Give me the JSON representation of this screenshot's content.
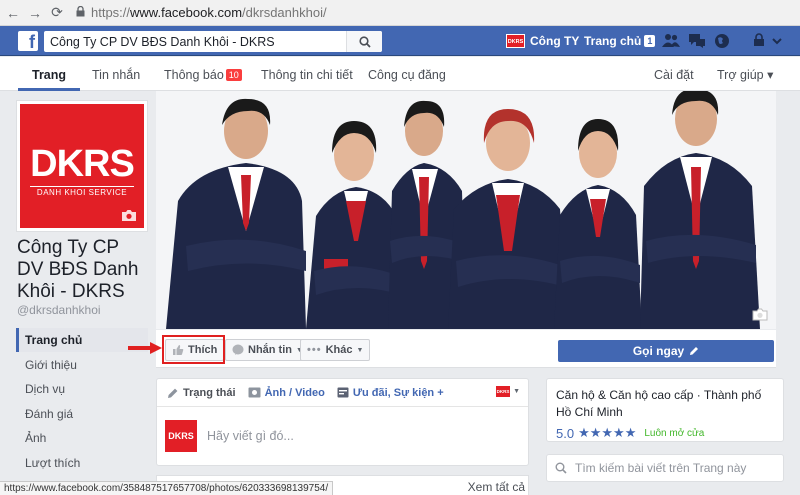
{
  "browser": {
    "url_scheme": "https://",
    "url_host": "www.facebook.com",
    "url_path": "/dkrsdanhkhoi/"
  },
  "topbar": {
    "search_value": "Công Ty CP DV BĐS Danh Khôi - DKRS",
    "account_label": "Công TY",
    "home_label": "Trang chủ",
    "home_count": "1",
    "mini_logo_text": "DKRS"
  },
  "tabs": [
    {
      "label": "Trang"
    },
    {
      "label": "Tin nhắn"
    },
    {
      "label": "Thông báo",
      "badge": "10"
    },
    {
      "label": "Thông tin chi tiết"
    },
    {
      "label": "Công cụ đăng"
    },
    {
      "label": "Cài đặt"
    },
    {
      "label": "Trợ giúp ▾"
    }
  ],
  "profile": {
    "logo_main": "DKRS",
    "logo_sub": "DANH KHOI SERVICE",
    "page_name": "Công Ty CP DV BĐS Danh Khôi - DKRS",
    "handle": "@dkrsdanhkhoi"
  },
  "left_nav": [
    "Trang chủ",
    "Giới thiệu",
    "Dịch vụ",
    "Đánh giá",
    "Ảnh",
    "Lượt thích"
  ],
  "actions": {
    "like": "Thích",
    "message": "Nhắn tin",
    "more": "Khác",
    "call": "Gọi ngay"
  },
  "composer": {
    "tab_status": "Trạng thái",
    "tab_photo": "Ảnh / Video",
    "tab_offer": "Ưu đãi, Sự kiện +",
    "avatar_text": "DKRS",
    "placeholder": "Hãy viết gì đó..."
  },
  "info": {
    "category": "Căn hộ & Căn hộ cao cấp · Thành phố Hồ Chí Minh",
    "rating": "5.0",
    "stars": "★★★★★",
    "open_status": "Luôn mở cửa"
  },
  "search_posts_placeholder": "Tìm kiếm bài viết trên Trang này",
  "see_all": "Xem tất cả",
  "status_url": "https://www.facebook.com/358487517657708/photos/620333698139754/",
  "colors": {
    "fb_blue": "#4267b2",
    "brand_red": "#e21f26",
    "highlight_red": "#e02020"
  }
}
